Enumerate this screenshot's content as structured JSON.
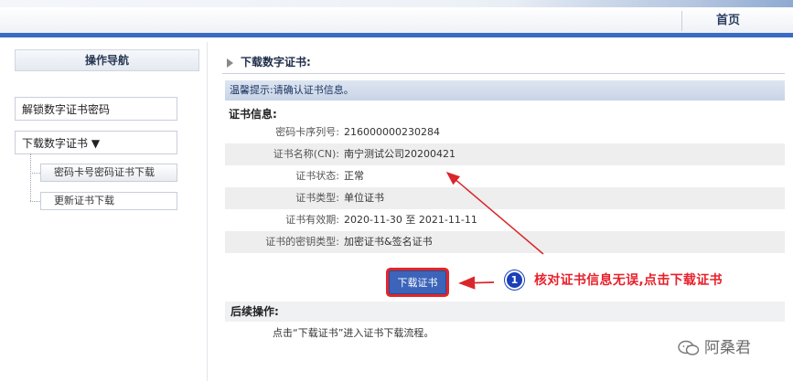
{
  "header": {
    "home_label": "首页"
  },
  "sidebar": {
    "title": "操作导航",
    "items": [
      {
        "label": "解锁数字证书密码"
      },
      {
        "label": "下载数字证书 ▼"
      }
    ],
    "subitems": [
      {
        "label": "密码卡号密码证书下载"
      },
      {
        "label": "更新证书下载"
      }
    ]
  },
  "main": {
    "title": "下载数字证书:",
    "tip": "温馨提示:请确认证书信息。",
    "info_title": "证书信息:",
    "fields": [
      {
        "label": "密码卡序列号:",
        "value": "216000000230284"
      },
      {
        "label": "证书名称(CN):",
        "value": "南宁测试公司20200421"
      },
      {
        "label": "证书状态:",
        "value": "正常"
      },
      {
        "label": "证书类型:",
        "value": "单位证书"
      },
      {
        "label": "证书有效期:",
        "value": "2020-11-30 至  2021-11-11"
      },
      {
        "label": "证书的密钥类型:",
        "value": "加密证书&签名证书"
      }
    ],
    "download_button": "下载证书",
    "followup_title": "后续操作:",
    "followup_text": "点击“下载证书”进入证书下载流程。"
  },
  "annotation": {
    "step_number": "1",
    "text": "核对证书信息无误,点击下载证书",
    "color": "#e8202b"
  },
  "watermark": {
    "text": "阿桑君"
  }
}
